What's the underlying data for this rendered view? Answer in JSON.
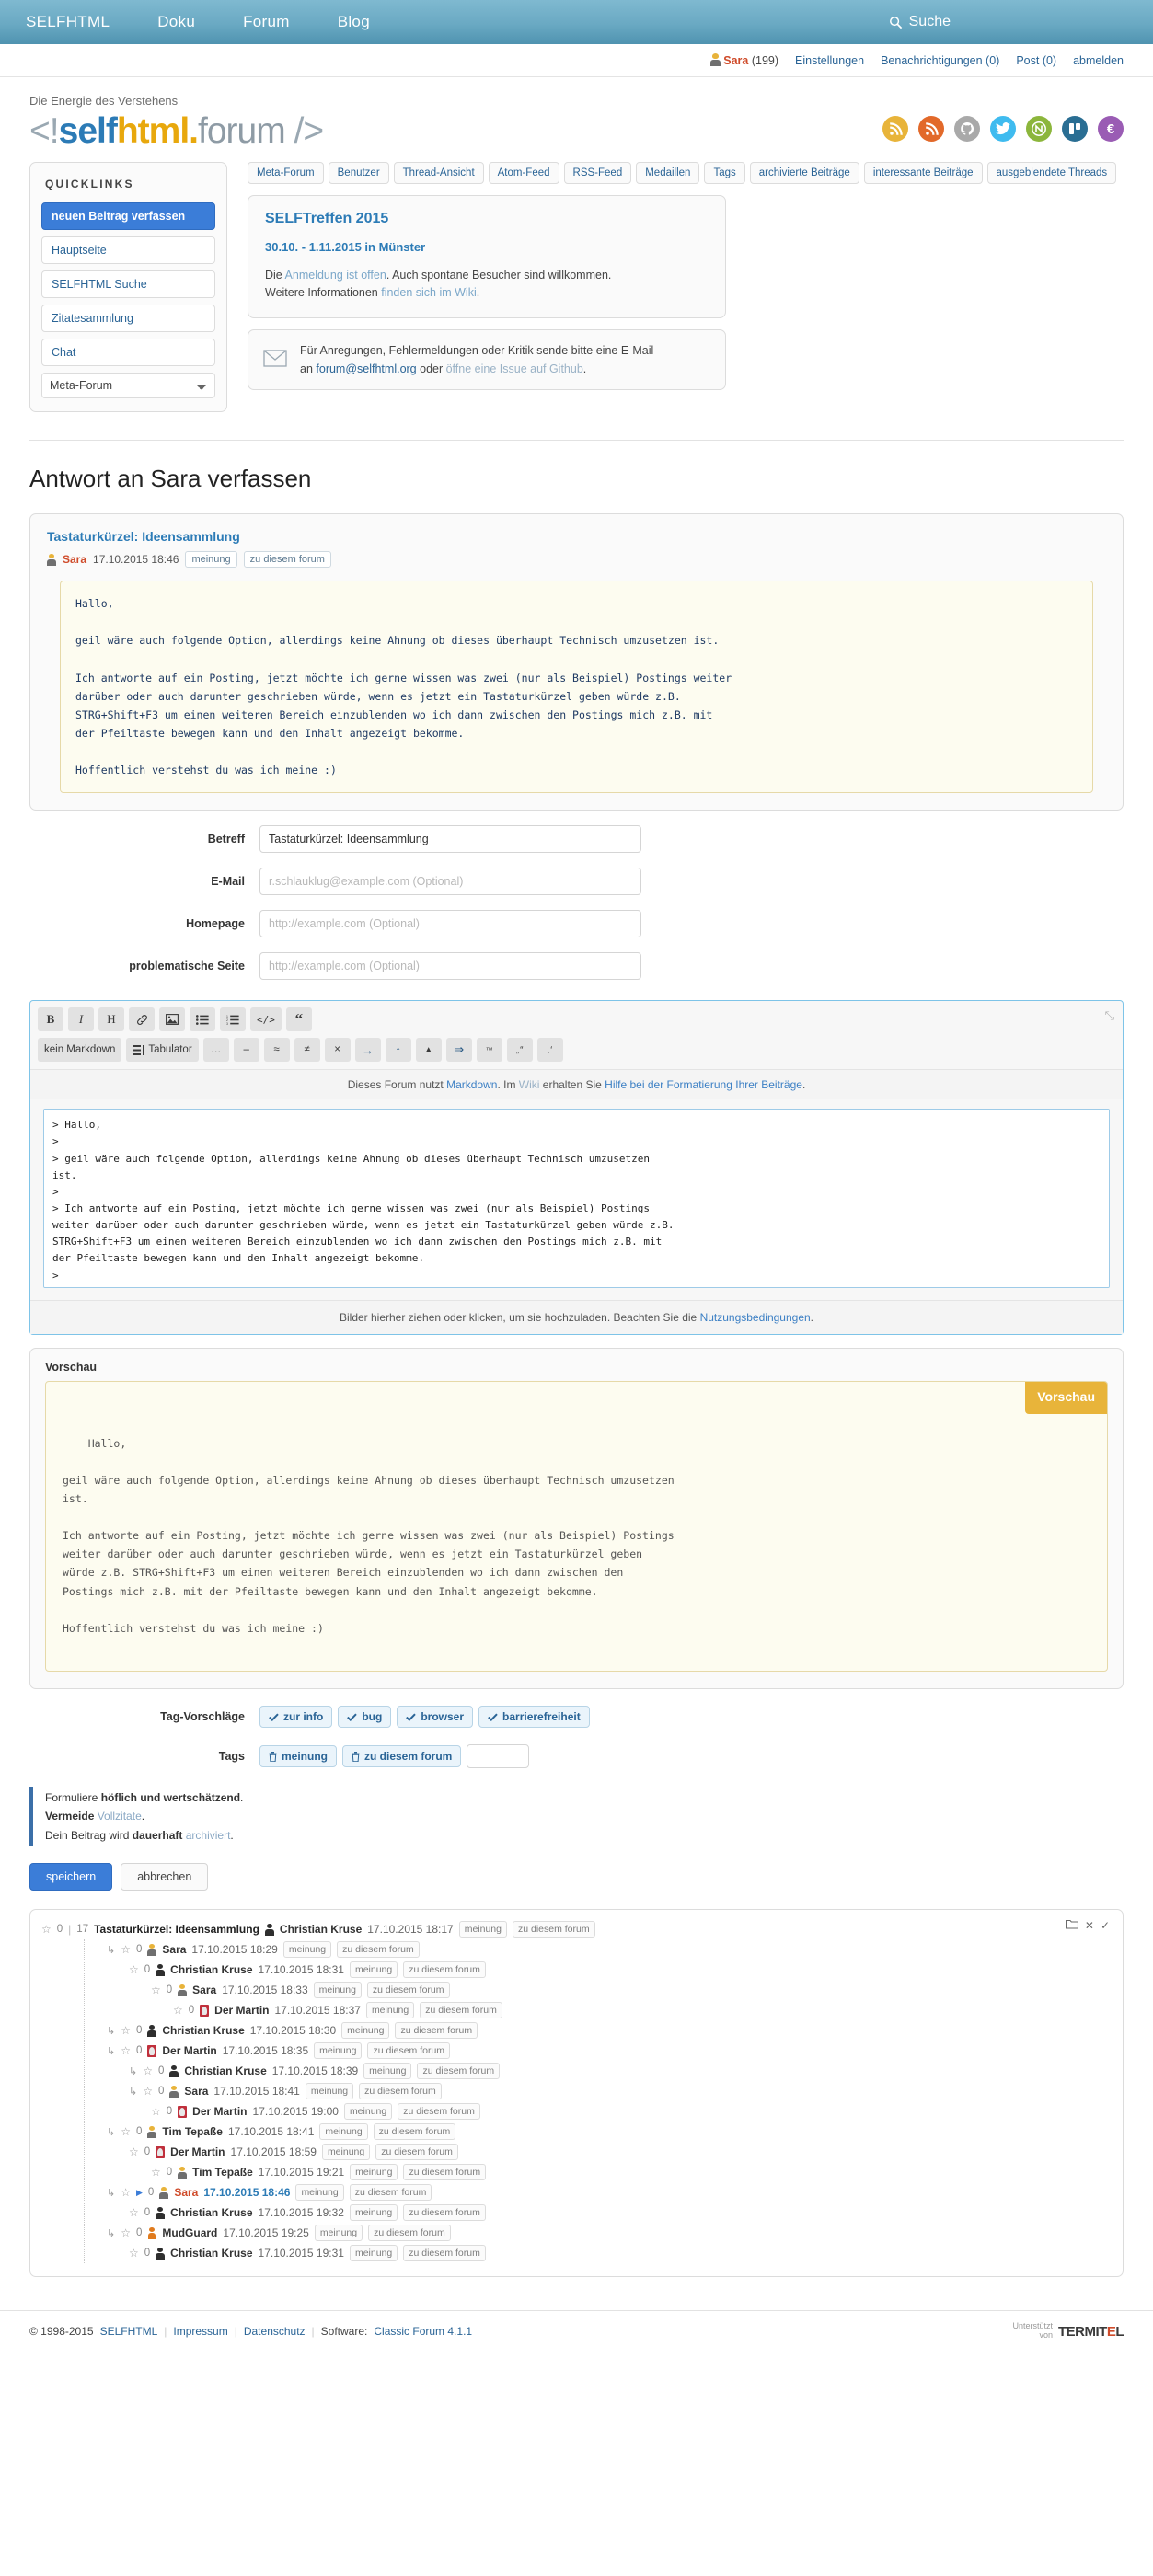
{
  "topnav": {
    "links": [
      "SELFHTML",
      "Doku",
      "Forum",
      "Blog"
    ],
    "search_label": "Suche"
  },
  "userbar": {
    "user": "Sara",
    "user_count": "(199)",
    "settings": "Einstellungen",
    "notifications": "Benachrichtigungen (0)",
    "post": "Post (0)",
    "logout": "abmelden"
  },
  "masthead": {
    "slogan": "Die Energie des Verstehens",
    "logo": {
      "open": "<!",
      "self": "self",
      "html": "html",
      "dot": ".",
      "forum": "forum",
      "close": "/>"
    },
    "socials": [
      {
        "name": "atom-feed-icon",
        "glyph": "◖",
        "color": "#e8b43a"
      },
      {
        "name": "rss-feed-icon",
        "glyph": "◖",
        "color": "#e2692a"
      },
      {
        "name": "github-icon",
        "glyph": "●",
        "color": "#a9a9a9"
      },
      {
        "name": "twitter-icon",
        "glyph": "●",
        "color": "#3fbbef"
      },
      {
        "name": "selfhtml-wiki-icon",
        "glyph": "●",
        "color": "#8cb63c"
      },
      {
        "name": "trello-icon",
        "glyph": "■",
        "color": "#2a6e93"
      },
      {
        "name": "donate-euro-icon",
        "glyph": "€",
        "color": "#9a5cb4"
      }
    ]
  },
  "sidebar": {
    "heading": "QUICKLINKS",
    "items": [
      {
        "label": "neuen Beitrag verfassen",
        "active": true
      },
      {
        "label": "Hauptseite",
        "active": false
      },
      {
        "label": "SELFHTML Suche",
        "active": false
      },
      {
        "label": "Zitatesammlung",
        "active": false
      },
      {
        "label": "Chat",
        "active": false
      }
    ],
    "select_value": "Meta-Forum"
  },
  "tabs": [
    "Meta-Forum",
    "Benutzer",
    "Thread-Ansicht",
    "Atom-Feed",
    "RSS-Feed",
    "Medaillen",
    "Tags",
    "archivierte Beiträge",
    "interessante Beiträge",
    "ausgeblendete Threads"
  ],
  "notice": {
    "title": "SELFTreffen 2015",
    "subtitle": "30.10. - 1.11.2015 in Münster",
    "line1_pre": "Die ",
    "line1_link": "Anmeldung ist offen",
    "line1_post": ". Auch spontane Besucher sind willkommen.",
    "line2_pre": "Weitere Informationen ",
    "line2_link": "finden sich im Wiki",
    "line2_post": "."
  },
  "mailbox": {
    "line1": "Für Anregungen, Fehlermeldungen oder Kritik sende bitte eine E-Mail",
    "line2_pre": "an ",
    "line2_link": "forum@selfhtml.org",
    "line2_mid": " oder ",
    "line2_link2": "öffne eine Issue auf Github",
    "line2_post": "."
  },
  "page_title": "Antwort an Sara verfassen",
  "quoted_post": {
    "title": "Tastaturkürzel: Ideensammlung",
    "author": "Sara",
    "date": "17.10.2015 18:46",
    "tags": [
      "meinung",
      "zu diesem forum"
    ],
    "body": "Hallo,\n\ngeil wäre auch folgende Option, allerdings keine Ahnung ob dieses überhaupt Technisch umzusetzen ist.\n\nIch antworte auf ein Posting, jetzt möchte ich gerne wissen was zwei (nur als Beispiel) Postings weiter\ndarüber oder auch darunter geschrieben würde, wenn es jetzt ein Tastaturkürzel geben würde z.B.\nSTRG+Shift+F3 um einen weiteren Bereich einzublenden wo ich dann zwischen den Postings mich z.B. mit\nder Pfeiltaste bewegen kann und den Inhalt angezeigt bekomme.\n\nHoffentlich verstehst du was ich meine :)"
  },
  "form": {
    "fields": [
      {
        "label": "Betreff",
        "value": "Tastaturkürzel: Ideensammlung",
        "placeholder": ""
      },
      {
        "label": "E-Mail",
        "value": "",
        "placeholder": "r.schlauklug@example.com (Optional)"
      },
      {
        "label": "Homepage",
        "value": "",
        "placeholder": "http://example.com (Optional)"
      },
      {
        "label": "problematische Seite",
        "value": "",
        "placeholder": "http://example.com (Optional)"
      }
    ]
  },
  "editor": {
    "toolbar_row1": [
      {
        "name": "bold-icon",
        "glyph": "B"
      },
      {
        "name": "italic-icon",
        "glyph": "I"
      },
      {
        "name": "heading-icon",
        "glyph": "H"
      },
      {
        "name": "link-icon",
        "glyph": "ὑ7"
      },
      {
        "name": "image-icon",
        "glyph": "ὛC"
      },
      {
        "name": "bullet-list-icon",
        "glyph": "☰"
      },
      {
        "name": "numbered-list-icon",
        "glyph": "☷"
      },
      {
        "name": "code-icon",
        "glyph": "</>"
      },
      {
        "name": "quote-icon",
        "glyph": "“"
      }
    ],
    "toolbar_row2": [
      {
        "name": "no-markdown-button",
        "glyph": "kein Markdown"
      },
      {
        "name": "tabulator-button",
        "glyph": "Tabulator"
      },
      {
        "name": "ellipsis-char",
        "glyph": "…"
      },
      {
        "name": "endash-char",
        "glyph": "–"
      },
      {
        "name": "approx-char",
        "glyph": "≈"
      },
      {
        "name": "notequal-char",
        "glyph": "≠"
      },
      {
        "name": "times-char",
        "glyph": "×"
      },
      {
        "name": "rightarrow-char",
        "glyph": "→"
      },
      {
        "name": "uparrow-char",
        "glyph": "↑"
      },
      {
        "name": "triangle-char",
        "glyph": "▲"
      },
      {
        "name": "doublearrow-char",
        "glyph": "⇒"
      },
      {
        "name": "trademark-char",
        "glyph": "™"
      },
      {
        "name": "doublequotes-char",
        "glyph": "„“"
      },
      {
        "name": "singlequotes-char",
        "glyph": "‚‘"
      }
    ],
    "expand_icon": "⤡",
    "md_hint_pre": "Dieses Forum nutzt ",
    "md_hint_markdown": "Markdown",
    "md_hint_mid": ". Im ",
    "md_hint_wiki": "Wiki",
    "md_hint_mid2": " erhalten Sie ",
    "md_hint_help": "Hilfe bei der Formatierung Ihrer Beiträge",
    "md_hint_post": ".",
    "textarea_value": "> Hallo,\n>\n> geil wäre auch folgende Option, allerdings keine Ahnung ob dieses überhaupt Technisch umzusetzen\nist.\n>\n> Ich antworte auf ein Posting, jetzt möchte ich gerne wissen was zwei (nur als Beispiel) Postings\nweiter darüber oder auch darunter geschrieben würde, wenn es jetzt ein Tastaturkürzel geben würde z.B.\nSTRG+Shift+F3 um einen weiteren Bereich einzublenden wo ich dann zwischen den Postings mich z.B. mit\nder Pfeiltaste bewegen kann und den Inhalt angezeigt bekomme.\n>\n> Hoffentlich verstehst du was ich meine :)\n>",
    "drop_pre": "Bilder hierher ziehen oder klicken, um sie hochzuladen. Beachten Sie die ",
    "drop_link": "Nutzungsbedingungen",
    "drop_post": "."
  },
  "preview": {
    "label": "Vorschau",
    "badge": "Vorschau",
    "body": "Hallo,\n\ngeil wäre auch folgende Option, allerdings keine Ahnung ob dieses überhaupt Technisch umzusetzen\nist.\n\nIch antworte auf ein Posting, jetzt möchte ich gerne wissen was zwei (nur als Beispiel) Postings\nweiter darüber oder auch darunter geschrieben würde, wenn es jetzt ein Tastaturkürzel geben\nwürde z.B. STRG+Shift+F3 um einen weiteren Bereich einzublenden wo ich dann zwischen den\nPostings mich z.B. mit der Pfeiltaste bewegen kann und den Inhalt angezeigt bekomme.\n\nHoffentlich verstehst du was ich meine :)"
  },
  "tags": {
    "suggestions_label": "Tag-Vorschläge",
    "suggestions": [
      "zur info",
      "bug",
      "browser",
      "barrierefreiheit"
    ],
    "tags_label": "Tags",
    "selected": [
      "meinung",
      "zu diesem forum"
    ],
    "input_value": ""
  },
  "rules": {
    "line1_pre": "Formuliere ",
    "line1_strong": "höflich und wertschätzend",
    "line1_post": ".",
    "line2_strong": "Vermeide",
    "line2_link": " Vollzitate",
    "line2_post": ".",
    "line3_pre": "Dein Beitrag wird ",
    "line3_strong": "dauerhaft",
    "line3_link": " archiviert",
    "line3_post": "."
  },
  "actions": {
    "save": "speichern",
    "cancel": "abbrechen"
  },
  "thread": {
    "root": {
      "stars": "0",
      "views": "17",
      "subject": "Tastaturkürzel: Ideensammlung",
      "author": "Christian Kruse",
      "avatar": "dark",
      "date": "17.10.2015 18:17",
      "tags": [
        "meinung",
        "zu diesem forum"
      ]
    },
    "tools": [
      "folder-icon",
      "close-icon",
      "check-icon"
    ],
    "replies": [
      {
        "depth": 1,
        "arrow": true,
        "stars": "0",
        "author": "Sara",
        "avatar": "yellow",
        "date": "17.10.2015 18:29",
        "tags": [
          "meinung",
          "zu diesem forum"
        ],
        "current": false
      },
      {
        "depth": 2,
        "arrow": false,
        "stars": "0",
        "author": "Christian Kruse",
        "avatar": "dark",
        "date": "17.10.2015 18:31",
        "tags": [
          "meinung",
          "zu diesem forum"
        ],
        "current": false
      },
      {
        "depth": 3,
        "arrow": false,
        "stars": "0",
        "author": "Sara",
        "avatar": "yellow",
        "date": "17.10.2015 18:33",
        "tags": [
          "meinung",
          "zu diesem forum"
        ],
        "current": false
      },
      {
        "depth": 4,
        "arrow": false,
        "stars": "0",
        "author": "Der Martin",
        "avatar": "red",
        "date": "17.10.2015 18:37",
        "tags": [
          "meinung",
          "zu diesem forum"
        ],
        "current": false
      },
      {
        "depth": 1,
        "arrow": true,
        "stars": "0",
        "author": "Christian Kruse",
        "avatar": "dark",
        "date": "17.10.2015 18:30",
        "tags": [
          "meinung",
          "zu diesem forum"
        ],
        "current": false
      },
      {
        "depth": 1,
        "arrow": true,
        "stars": "0",
        "author": "Der Martin",
        "avatar": "red",
        "date": "17.10.2015 18:35",
        "tags": [
          "meinung",
          "zu diesem forum"
        ],
        "current": false
      },
      {
        "depth": 2,
        "arrow": true,
        "stars": "0",
        "author": "Christian Kruse",
        "avatar": "dark",
        "date": "17.10.2015 18:39",
        "tags": [
          "meinung",
          "zu diesem forum"
        ],
        "current": false
      },
      {
        "depth": 2,
        "arrow": true,
        "stars": "0",
        "author": "Sara",
        "avatar": "yellow",
        "date": "17.10.2015 18:41",
        "tags": [
          "meinung",
          "zu diesem forum"
        ],
        "current": false
      },
      {
        "depth": 3,
        "arrow": false,
        "stars": "0",
        "author": "Der Martin",
        "avatar": "red",
        "date": "17.10.2015 19:00",
        "tags": [
          "meinung",
          "zu diesem forum"
        ],
        "current": false
      },
      {
        "depth": 1,
        "arrow": true,
        "stars": "0",
        "author": "Tim Tepaße",
        "avatar": "yellow",
        "date": "17.10.2015 18:41",
        "tags": [
          "meinung",
          "zu diesem forum"
        ],
        "current": false
      },
      {
        "depth": 2,
        "arrow": false,
        "stars": "0",
        "author": "Der Martin",
        "avatar": "red",
        "date": "17.10.2015 18:59",
        "tags": [
          "meinung",
          "zu diesem forum"
        ],
        "current": false
      },
      {
        "depth": 3,
        "arrow": false,
        "stars": "0",
        "author": "Tim Tepaße",
        "avatar": "yellow",
        "date": "17.10.2015 19:21",
        "tags": [
          "meinung",
          "zu diesem forum"
        ],
        "current": false
      },
      {
        "depth": 1,
        "arrow": true,
        "stars": "0",
        "author": "Sara",
        "avatar": "yellow",
        "date": "17.10.2015 18:46",
        "tags": [
          "meinung",
          "zu diesem forum"
        ],
        "current": true
      },
      {
        "depth": 2,
        "arrow": false,
        "stars": "0",
        "author": "Christian Kruse",
        "avatar": "dark",
        "date": "17.10.2015 19:32",
        "tags": [
          "meinung",
          "zu diesem forum"
        ],
        "current": false
      },
      {
        "depth": 1,
        "arrow": true,
        "stars": "0",
        "author": "MudGuard",
        "avatar": "orange",
        "date": "17.10.2015 19:25",
        "tags": [
          "meinung",
          "zu diesem forum"
        ],
        "current": false
      },
      {
        "depth": 2,
        "arrow": false,
        "stars": "0",
        "author": "Christian Kruse",
        "avatar": "dark",
        "date": "17.10.2015 19:31",
        "tags": [
          "meinung",
          "zu diesem forum"
        ],
        "current": false
      }
    ]
  },
  "footer": {
    "copyright": "© 1998-2015",
    "selfhtml": "SELFHTML",
    "impressum": "Impressum",
    "datenschutz": "Datenschutz",
    "software_label": "Software:",
    "software": "Classic Forum 4.1.1",
    "sponsor_pre": "Unterstützt",
    "sponsor_pre2": "von",
    "sponsor_name": "TERMITEL"
  }
}
